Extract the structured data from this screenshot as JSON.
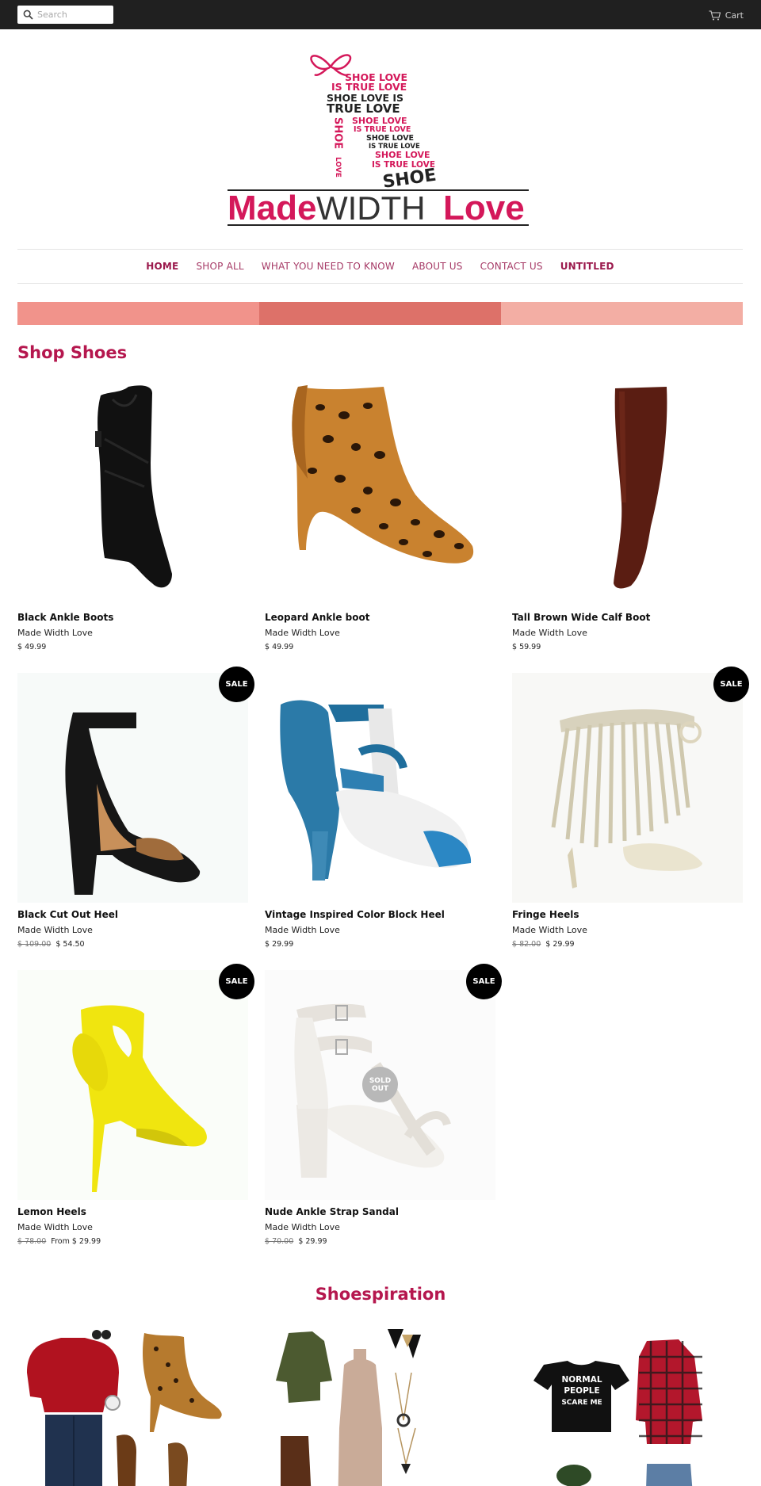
{
  "search": {
    "placeholder": "Search"
  },
  "cart": {
    "label": "Cart"
  },
  "logo": {
    "tagline_lines": [
      "SHOE LOVE",
      "IS TRUE LOVE",
      "SHOE LOVE IS",
      "TRUE LOVE",
      "SHOE LOVE",
      "IS TRUE LOVE",
      "SHOE LOVE",
      "IS TRUE LOVE",
      "SHOE LOVE",
      "IS TRUE LOVE",
      "SHOE"
    ],
    "vertical_word": "SHOE",
    "vertical_word2": "LOVE",
    "brand_made": "Made",
    "brand_width": "WIDTH",
    "brand_love": "Love"
  },
  "nav": {
    "items": [
      {
        "label": "HOME"
      },
      {
        "label": "SHOP ALL"
      },
      {
        "label": "WHAT YOU NEED TO KNOW"
      },
      {
        "label": "ABOUT US"
      },
      {
        "label": "CONTACT US"
      },
      {
        "label": "UNTITLED"
      }
    ]
  },
  "colors": {
    "accent": "#b5174e",
    "stripe1": "#f1938b",
    "stripe2": "#dd7169",
    "stripe3": "#f3aea4",
    "topbar": "#202020"
  },
  "shop": {
    "title": "Shop Shoes",
    "products": [
      {
        "title": "Black Ankle Boots",
        "vendor": "Made Width Love",
        "old_price": "",
        "price": "$ 49.99",
        "badge": ""
      },
      {
        "title": "Leopard Ankle boot",
        "vendor": "Made Width Love",
        "old_price": "",
        "price": "$ 49.99",
        "badge": ""
      },
      {
        "title": "Tall Brown Wide Calf Boot",
        "vendor": "Made Width Love",
        "old_price": "",
        "price": "$ 59.99",
        "badge": ""
      },
      {
        "title": "Black Cut Out Heel",
        "vendor": "Made Width Love",
        "old_price": "$ 109.00",
        "price": "$ 54.50",
        "badge": "SALE"
      },
      {
        "title": "Vintage Inspired Color Block Heel",
        "vendor": "Made Width Love",
        "old_price": "",
        "price": "$ 29.99",
        "badge": ""
      },
      {
        "title": "Fringe Heels",
        "vendor": "Made Width Love",
        "old_price": "$ 82.00",
        "price": "$ 29.99",
        "badge": "SALE"
      },
      {
        "title": "Lemon Heels",
        "vendor": "Made Width Love",
        "old_price": "$ 78.00",
        "price": "From $ 29.99",
        "badge": "SALE"
      },
      {
        "title": "Nude Ankle Strap Sandal",
        "vendor": "Made Width Love",
        "old_price": "$ 70.00",
        "price": "$ 29.99",
        "badge": "SALE",
        "sold_line1": "SOLD",
        "sold_line2": "OUT"
      }
    ]
  },
  "inspiration": {
    "title": "Shoespiration",
    "tee_text": [
      "NORMAL",
      "PEOPLE",
      "SCARE ME"
    ]
  }
}
